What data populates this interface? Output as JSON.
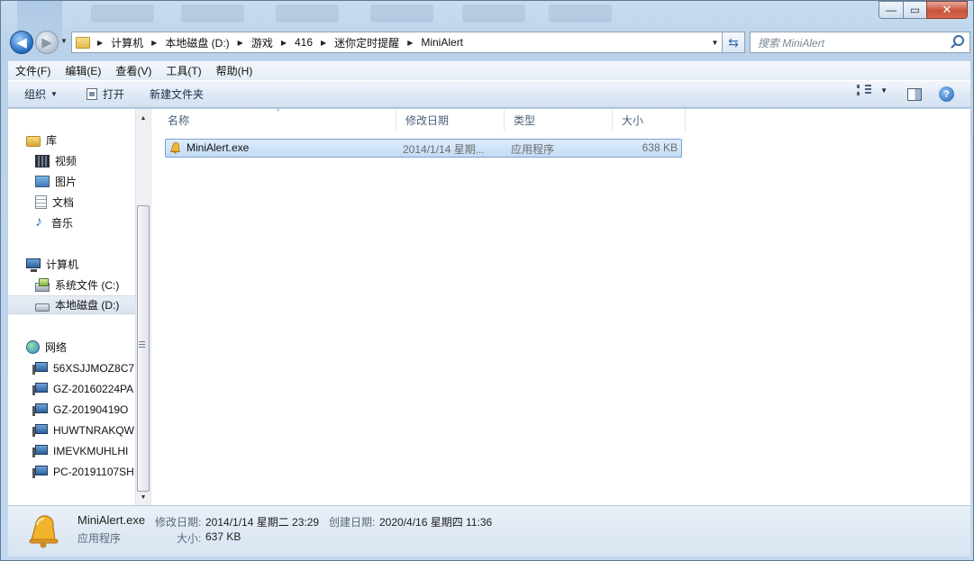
{
  "window": {
    "caption_min": "—",
    "caption_max": "▭",
    "caption_close": "✕"
  },
  "nav": {
    "back_glyph": "◀",
    "forward_glyph": "▶",
    "history_glyph": "▼",
    "address_dropdown_glyph": "▼",
    "refresh_glyph": "⇆",
    "breadcrumb": [
      "计算机",
      "本地磁盘 (D:)",
      "游戏",
      "416",
      "迷你定时提醒",
      "MiniAlert"
    ],
    "search_placeholder": "搜索 MiniAlert"
  },
  "menubar": {
    "items": [
      "文件(F)",
      "编辑(E)",
      "查看(V)",
      "工具(T)",
      "帮助(H)"
    ]
  },
  "toolbar": {
    "organize_label": "组织",
    "open_label": "打开",
    "new_folder_label": "新建文件夹",
    "dropdown_glyph": "▼",
    "help_glyph": "?"
  },
  "navpane": {
    "favorites_items": [],
    "library_label": "库",
    "library_items": [
      "视频",
      "图片",
      "文档",
      "音乐"
    ],
    "computer_label": "计算机",
    "computer_items": [
      "系统文件 (C:)",
      "本地磁盘 (D:)"
    ],
    "network_label": "网络",
    "network_items": [
      "56XSJJMOZ8C7",
      "GZ-20160224PA",
      "GZ-20190419O",
      "HUWTNRAKQW",
      "IMEVKMUHLHI",
      "PC-20191107SH"
    ],
    "scroll_up_glyph": "▲",
    "scroll_down_glyph": "▼"
  },
  "columns": [
    "名称",
    "修改日期",
    "类型",
    "大小"
  ],
  "sort_glyph": "^",
  "files": [
    {
      "name": "MiniAlert.exe",
      "modified": "2014/1/14 星期...",
      "type": "应用程序",
      "size": "638 KB"
    }
  ],
  "details": {
    "name": "MiniAlert.exe",
    "modified_label": "修改日期:",
    "modified_value": "2014/1/14 星期二 23:29",
    "created_label": "创建日期:",
    "created_value": "2020/4/16 星期四 11:36",
    "type": "应用程序",
    "size_label": "大小:",
    "size_value": "637 KB"
  },
  "colors": {
    "selection": "#cfe3f8",
    "selection_border": "#7da2ce",
    "chrome": "#c9dcef",
    "accent": "#2a6fc4"
  },
  "icons": {
    "file_icon": "bell-icon",
    "library": "library-icon",
    "computer": "computer-icon",
    "network": "network-icon"
  }
}
